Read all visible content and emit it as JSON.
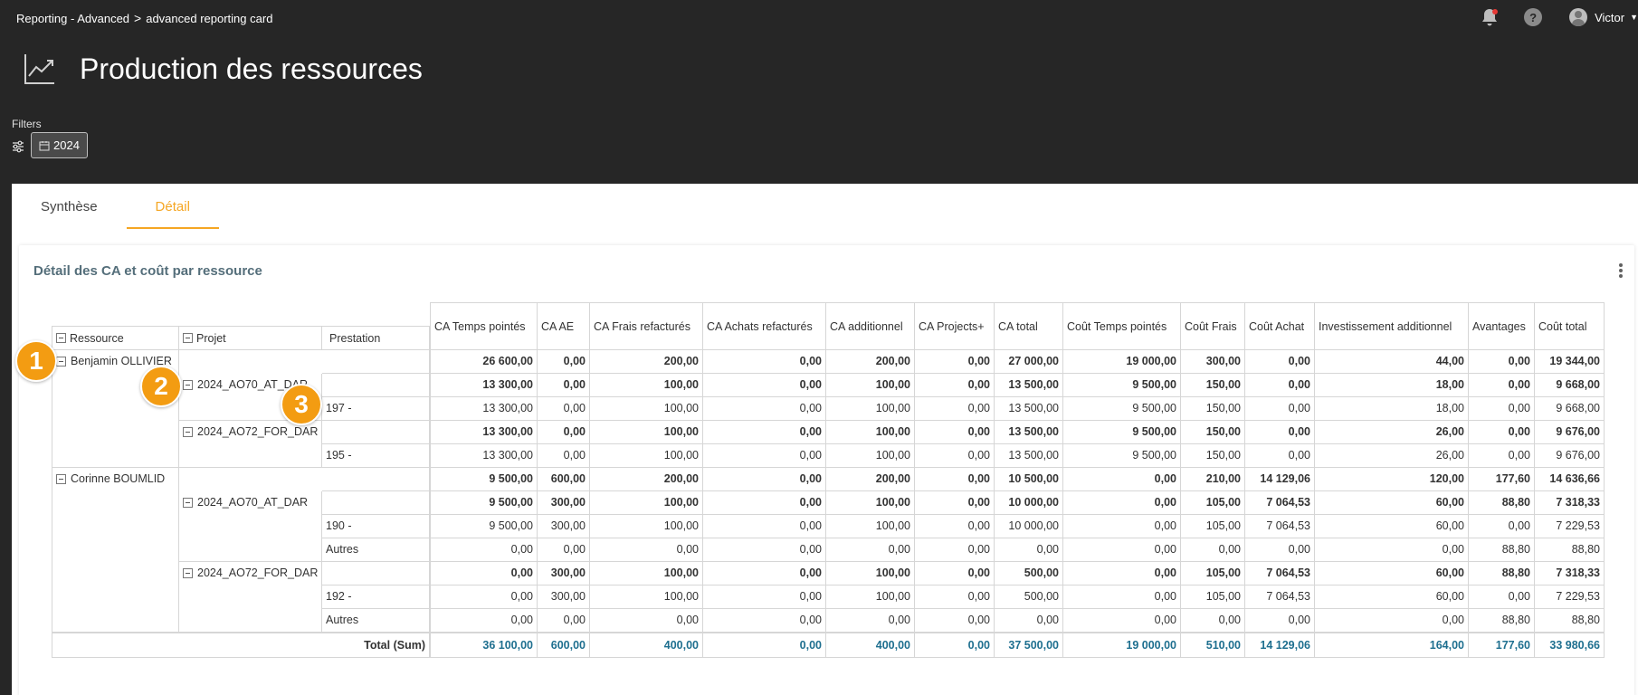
{
  "breadcrumb": {
    "parent": "Reporting - Advanced",
    "separator": ">",
    "current": "advanced reporting card"
  },
  "user": {
    "name": "Victor"
  },
  "page": {
    "title": "Production des ressources"
  },
  "filters": {
    "label": "Filters",
    "chip": "2024"
  },
  "tabs": [
    {
      "label": "Synthèse",
      "active": false
    },
    {
      "label": "Détail",
      "active": true
    }
  ],
  "card": {
    "title": "Détail des CA et coût par ressource"
  },
  "table": {
    "dim_headers": [
      "Ressource",
      "Projet",
      "Prestation"
    ],
    "columns": [
      "CA Temps pointés",
      "CA AE",
      "CA Frais refacturés",
      "CA Achats refacturés",
      "CA additionnel",
      "CA Projects+",
      "CA total",
      "Coût Temps pointés",
      "Coût Frais",
      "Coût Achat",
      "Investissement additionnel",
      "Avantages",
      "Coût total"
    ],
    "rows": [
      {
        "level": 0,
        "label": "Benjamin OLLIVIER",
        "values": [
          "26 600,00",
          "0,00",
          "200,00",
          "0,00",
          "200,00",
          "0,00",
          "27 000,00",
          "19 000,00",
          "300,00",
          "0,00",
          "44,00",
          "0,00",
          "19 344,00"
        ]
      },
      {
        "level": 1,
        "label": "2024_AO70_AT_DAR",
        "values": [
          "13 300,00",
          "0,00",
          "100,00",
          "0,00",
          "100,00",
          "0,00",
          "13 500,00",
          "9 500,00",
          "150,00",
          "0,00",
          "18,00",
          "0,00",
          "9 668,00"
        ]
      },
      {
        "level": 2,
        "label": "197 -",
        "values": [
          "13 300,00",
          "0,00",
          "100,00",
          "0,00",
          "100,00",
          "0,00",
          "13 500,00",
          "9 500,00",
          "150,00",
          "0,00",
          "18,00",
          "0,00",
          "9 668,00"
        ]
      },
      {
        "level": 1,
        "label": "2024_AO72_FOR_DAR",
        "values": [
          "13 300,00",
          "0,00",
          "100,00",
          "0,00",
          "100,00",
          "0,00",
          "13 500,00",
          "9 500,00",
          "150,00",
          "0,00",
          "26,00",
          "0,00",
          "9 676,00"
        ]
      },
      {
        "level": 2,
        "label": "195 -",
        "values": [
          "13 300,00",
          "0,00",
          "100,00",
          "0,00",
          "100,00",
          "0,00",
          "13 500,00",
          "9 500,00",
          "150,00",
          "0,00",
          "26,00",
          "0,00",
          "9 676,00"
        ]
      },
      {
        "level": 0,
        "label": "Corinne BOUMLID",
        "values": [
          "9 500,00",
          "600,00",
          "200,00",
          "0,00",
          "200,00",
          "0,00",
          "10 500,00",
          "0,00",
          "210,00",
          "14 129,06",
          "120,00",
          "177,60",
          "14 636,66"
        ]
      },
      {
        "level": 1,
        "label": "2024_AO70_AT_DAR",
        "values": [
          "9 500,00",
          "300,00",
          "100,00",
          "0,00",
          "100,00",
          "0,00",
          "10 000,00",
          "0,00",
          "105,00",
          "7 064,53",
          "60,00",
          "88,80",
          "7 318,33"
        ]
      },
      {
        "level": 2,
        "label": "190 -",
        "values": [
          "9 500,00",
          "300,00",
          "100,00",
          "0,00",
          "100,00",
          "0,00",
          "10 000,00",
          "0,00",
          "105,00",
          "7 064,53",
          "60,00",
          "0,00",
          "7 229,53"
        ]
      },
      {
        "level": 2,
        "label": "Autres",
        "values": [
          "0,00",
          "0,00",
          "0,00",
          "0,00",
          "0,00",
          "0,00",
          "0,00",
          "0,00",
          "0,00",
          "0,00",
          "0,00",
          "88,80",
          "88,80"
        ]
      },
      {
        "level": 1,
        "label": "2024_AO72_FOR_DAR",
        "values": [
          "0,00",
          "300,00",
          "100,00",
          "0,00",
          "100,00",
          "0,00",
          "500,00",
          "0,00",
          "105,00",
          "7 064,53",
          "60,00",
          "88,80",
          "7 318,33"
        ]
      },
      {
        "level": 2,
        "label": "192 -",
        "values": [
          "0,00",
          "300,00",
          "100,00",
          "0,00",
          "100,00",
          "0,00",
          "500,00",
          "0,00",
          "105,00",
          "7 064,53",
          "60,00",
          "0,00",
          "7 229,53"
        ]
      },
      {
        "level": 2,
        "label": "Autres",
        "values": [
          "0,00",
          "0,00",
          "0,00",
          "0,00",
          "0,00",
          "0,00",
          "0,00",
          "0,00",
          "0,00",
          "0,00",
          "0,00",
          "88,80",
          "88,80"
        ]
      }
    ],
    "total": {
      "label": "Total (Sum)",
      "values": [
        "36 100,00",
        "600,00",
        "400,00",
        "0,00",
        "400,00",
        "0,00",
        "37 500,00",
        "19 000,00",
        "510,00",
        "14 129,06",
        "164,00",
        "177,60",
        "33 980,66"
      ]
    }
  },
  "markers": [
    "1",
    "2",
    "3"
  ],
  "colors": {
    "accent": "#f5a623",
    "marker": "#f39c12",
    "total_text": "#1e6f8f",
    "header_bg": "#262626"
  }
}
